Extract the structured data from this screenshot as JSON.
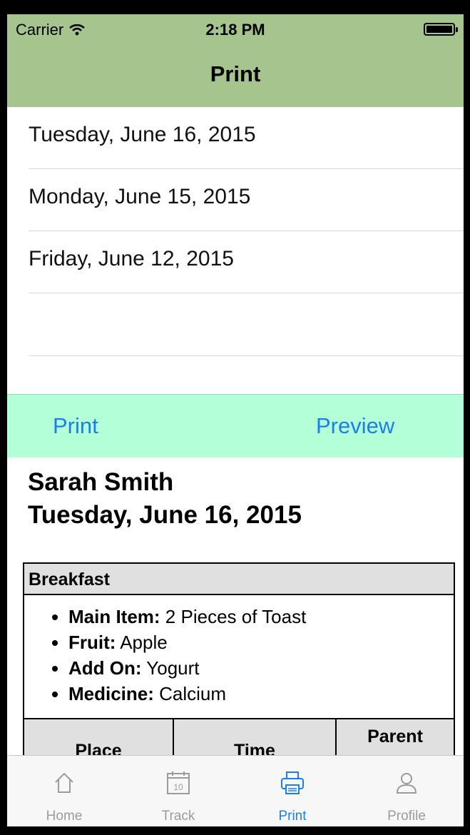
{
  "status": {
    "carrier": "Carrier",
    "time": "2:18 PM"
  },
  "nav": {
    "title": "Print"
  },
  "dates": [
    "Tuesday, June 16, 2015",
    "Monday, June 15, 2015",
    "Friday, June 12, 2015"
  ],
  "actions": {
    "print": "Print",
    "preview": "Preview"
  },
  "preview": {
    "name": "Sarah Smith",
    "date": "Tuesday, June 16, 2015",
    "meal": "Breakfast",
    "items": [
      {
        "label": "Main Item:",
        "value": " 2 Pieces of Toast"
      },
      {
        "label": "Fruit:",
        "value": " Apple"
      },
      {
        "label": "Add On:",
        "value": " Yogurt"
      },
      {
        "label": "Medicine:",
        "value": " Calcium"
      }
    ],
    "columns": [
      "Place",
      "Time",
      "Parent"
    ]
  },
  "tabs": [
    {
      "label": "Home",
      "icon": "home-icon"
    },
    {
      "label": "Track",
      "icon": "calendar-icon"
    },
    {
      "label": "Print",
      "icon": "printer-icon"
    },
    {
      "label": "Profile",
      "icon": "person-icon"
    }
  ],
  "colors": {
    "navbar": "#a6c48e",
    "action_bar": "#b2ffd8",
    "accent": "#1a7fe8"
  }
}
